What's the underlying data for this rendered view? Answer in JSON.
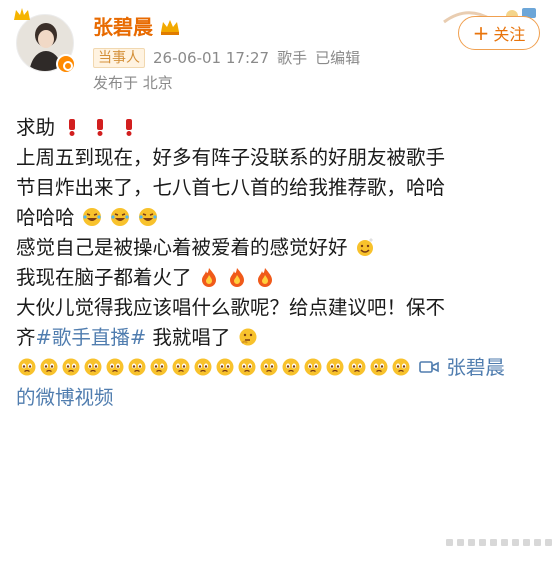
{
  "post": {
    "author": {
      "name": "张碧晨",
      "badge": "当事人",
      "timestamp": "26-06-01 17:27",
      "role": "歌手",
      "edited": "已编辑",
      "location": "发布于 北京"
    },
    "follow_label": "关注",
    "follow_plus": "+",
    "lines": [
      "求助",
      "上周五到现在，好多有阵子没联系的好朋友被歌手",
      "节目炸出来了，七八首七八首的给我推荐歌，哈哈",
      "哈哈哈",
      "感觉自己是被操心着被爱着的感觉好好",
      "我现在脑子都着火了",
      "大伙儿觉得我应该唱什么歌呢？给点建议吧！保不",
      "齐",
      "我就唱了"
    ],
    "hashtag": "#歌手直播#",
    "video_link": {
      "icon": "video-icon",
      "text_part1": "张碧晨",
      "text_part2": "的微博视频"
    }
  },
  "colors": {
    "username": "#e86a00",
    "link": "#507daf",
    "meta": "#8a8a8a",
    "follow": "#e8740c"
  },
  "icons": {
    "exclaim": "red-exclamation-icon",
    "laugh": "laughing-crying-emoji",
    "love": "love-emoji",
    "fire": "fire-emoji",
    "think": "thinking-emoji",
    "plead": "pleading-emoji"
  }
}
